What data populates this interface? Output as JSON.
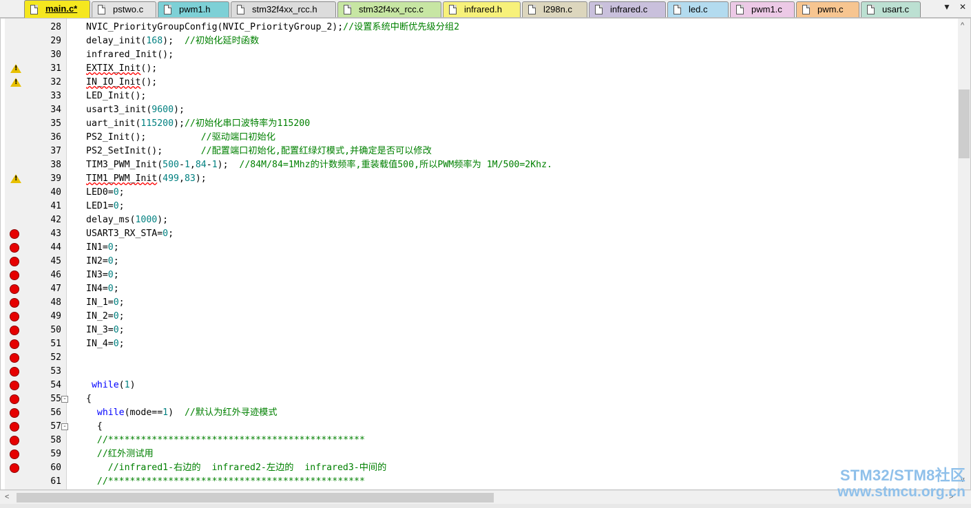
{
  "tabs": [
    {
      "label": "main.c*",
      "color": "#f5e71f",
      "active": true
    },
    {
      "label": "pstwo.c",
      "color": "#e3e3e3",
      "active": false
    },
    {
      "label": "pwm1.h",
      "color": "#7dd0d6",
      "active": false
    },
    {
      "label": "stm32f4xx_rcc.h",
      "color": "#dcdcdc",
      "active": false
    },
    {
      "label": "stm32f4xx_rcc.c",
      "color": "#c7e6a3",
      "active": false
    },
    {
      "label": "infrared.h",
      "color": "#f7f17a",
      "active": false
    },
    {
      "label": "l298n.c",
      "color": "#dcd6bd",
      "active": false
    },
    {
      "label": "infrared.c",
      "color": "#c9c0dc",
      "active": false
    },
    {
      "label": "led.c",
      "color": "#b3dbef",
      "active": false
    },
    {
      "label": "pwm1.c",
      "color": "#ecc9e6",
      "active": false
    },
    {
      "label": "pwm.c",
      "color": "#f7c590",
      "active": false
    },
    {
      "label": "usart.c",
      "color": "#bce0d2",
      "active": false
    }
  ],
  "tab_menu_icon": "▼",
  "tab_close_icon": "✕",
  "scroll_icons": {
    "up": "^",
    "down": "v",
    "left": "<",
    "right": ">"
  },
  "lines": [
    {
      "num": "28",
      "marker": "",
      "fold": "",
      "code": [
        [
          "t",
          "NVIC_PriorityGroupConfig(NVIC_PriorityGroup_2);"
        ],
        [
          "c",
          "//设置系统中断优先级分组2"
        ]
      ]
    },
    {
      "num": "29",
      "marker": "",
      "fold": "",
      "code": [
        [
          "t",
          "delay_init("
        ],
        [
          "n",
          "168"
        ],
        [
          "t",
          ");  "
        ],
        [
          "c",
          "//初始化延时函数"
        ]
      ]
    },
    {
      "num": "30",
      "marker": "",
      "fold": "",
      "code": [
        [
          "t",
          "infrared_Init();"
        ]
      ]
    },
    {
      "num": "31",
      "marker": "warning",
      "fold": "",
      "code": [
        [
          "e",
          "EXTIX_Init"
        ],
        [
          "t",
          "();"
        ]
      ]
    },
    {
      "num": "32",
      "marker": "warning",
      "fold": "",
      "code": [
        [
          "e",
          "IN_IO_Init"
        ],
        [
          "t",
          "();"
        ]
      ]
    },
    {
      "num": "33",
      "marker": "",
      "fold": "",
      "code": [
        [
          "t",
          "LED_Init();"
        ]
      ]
    },
    {
      "num": "34",
      "marker": "",
      "fold": "",
      "code": [
        [
          "t",
          "usart3_init("
        ],
        [
          "n",
          "9600"
        ],
        [
          "t",
          ");"
        ]
      ]
    },
    {
      "num": "35",
      "marker": "",
      "fold": "",
      "code": [
        [
          "t",
          "uart_init("
        ],
        [
          "n",
          "115200"
        ],
        [
          "t",
          ");"
        ],
        [
          "c",
          "//初始化串口波特率为115200"
        ]
      ]
    },
    {
      "num": "36",
      "marker": "",
      "fold": "",
      "code": [
        [
          "t",
          "PS2_Init();          "
        ],
        [
          "c",
          "//驱动端口初始化"
        ]
      ]
    },
    {
      "num": "37",
      "marker": "",
      "fold": "",
      "code": [
        [
          "t",
          "PS2_SetInit();       "
        ],
        [
          "c",
          "//配置端口初始化,配置红绿灯模式,并确定是否可以修改"
        ]
      ]
    },
    {
      "num": "38",
      "marker": "",
      "fold": "",
      "code": [
        [
          "t",
          "TIM3_PWM_Init("
        ],
        [
          "n",
          "500"
        ],
        [
          "t",
          "-"
        ],
        [
          "n",
          "1"
        ],
        [
          "t",
          ","
        ],
        [
          "n",
          "84"
        ],
        [
          "t",
          "-"
        ],
        [
          "n",
          "1"
        ],
        [
          "t",
          ");  "
        ],
        [
          "c",
          "//84M/84=1Mhz的计数频率,重装载值500,所以PWM频率为 1M/500=2Khz."
        ]
      ]
    },
    {
      "num": "39",
      "marker": "warning",
      "fold": "",
      "code": [
        [
          "e",
          "TIM1_PWM_Init"
        ],
        [
          "t",
          "("
        ],
        [
          "n",
          "499"
        ],
        [
          "t",
          ","
        ],
        [
          "n",
          "83"
        ],
        [
          "t",
          ");"
        ]
      ]
    },
    {
      "num": "40",
      "marker": "",
      "fold": "",
      "code": [
        [
          "t",
          "LED0="
        ],
        [
          "n",
          "0"
        ],
        [
          "t",
          ";"
        ]
      ]
    },
    {
      "num": "41",
      "marker": "",
      "fold": "",
      "code": [
        [
          "t",
          "LED1="
        ],
        [
          "n",
          "0"
        ],
        [
          "t",
          ";"
        ]
      ]
    },
    {
      "num": "42",
      "marker": "",
      "fold": "",
      "code": [
        [
          "t",
          "delay_ms("
        ],
        [
          "n",
          "1000"
        ],
        [
          "t",
          ");"
        ]
      ]
    },
    {
      "num": "43",
      "marker": "breakpoint",
      "fold": "",
      "code": [
        [
          "t",
          "USART3_RX_STA="
        ],
        [
          "n",
          "0"
        ],
        [
          "t",
          ";"
        ]
      ]
    },
    {
      "num": "44",
      "marker": "breakpoint",
      "fold": "",
      "code": [
        [
          "t",
          "IN1="
        ],
        [
          "n",
          "0"
        ],
        [
          "t",
          ";"
        ]
      ]
    },
    {
      "num": "45",
      "marker": "breakpoint",
      "fold": "",
      "code": [
        [
          "t",
          "IN2="
        ],
        [
          "n",
          "0"
        ],
        [
          "t",
          ";"
        ]
      ]
    },
    {
      "num": "46",
      "marker": "breakpoint",
      "fold": "",
      "code": [
        [
          "t",
          "IN3="
        ],
        [
          "n",
          "0"
        ],
        [
          "t",
          ";"
        ]
      ]
    },
    {
      "num": "47",
      "marker": "breakpoint",
      "fold": "",
      "code": [
        [
          "t",
          "IN4="
        ],
        [
          "n",
          "0"
        ],
        [
          "t",
          ";"
        ]
      ]
    },
    {
      "num": "48",
      "marker": "breakpoint",
      "fold": "",
      "code": [
        [
          "t",
          "IN_1="
        ],
        [
          "n",
          "0"
        ],
        [
          "t",
          ";"
        ]
      ]
    },
    {
      "num": "49",
      "marker": "breakpoint",
      "fold": "",
      "code": [
        [
          "t",
          "IN_2="
        ],
        [
          "n",
          "0"
        ],
        [
          "t",
          ";"
        ]
      ]
    },
    {
      "num": "50",
      "marker": "breakpoint",
      "fold": "",
      "code": [
        [
          "t",
          "IN_3="
        ],
        [
          "n",
          "0"
        ],
        [
          "t",
          ";"
        ]
      ]
    },
    {
      "num": "51",
      "marker": "breakpoint",
      "fold": "",
      "code": [
        [
          "t",
          "IN_4="
        ],
        [
          "n",
          "0"
        ],
        [
          "t",
          ";"
        ]
      ]
    },
    {
      "num": "52",
      "marker": "breakpoint",
      "fold": "",
      "code": []
    },
    {
      "num": "53",
      "marker": "breakpoint",
      "fold": "",
      "code": []
    },
    {
      "num": "54",
      "marker": "breakpoint",
      "fold": "",
      "code": [
        [
          "t",
          " "
        ],
        [
          "k",
          "while"
        ],
        [
          "t",
          "("
        ],
        [
          "n",
          "1"
        ],
        [
          "t",
          ")"
        ]
      ]
    },
    {
      "num": "55",
      "marker": "breakpoint",
      "fold": "-",
      "code": [
        [
          "t",
          "{"
        ]
      ]
    },
    {
      "num": "56",
      "marker": "breakpoint",
      "fold": "",
      "code": [
        [
          "t",
          "  "
        ],
        [
          "k",
          "while"
        ],
        [
          "t",
          "(mode=="
        ],
        [
          "n",
          "1"
        ],
        [
          "t",
          ")  "
        ],
        [
          "c",
          "//默认为红外寻迹模式"
        ]
      ]
    },
    {
      "num": "57",
      "marker": "breakpoint",
      "fold": "-",
      "code": [
        [
          "t",
          "  {"
        ]
      ]
    },
    {
      "num": "58",
      "marker": "breakpoint",
      "fold": "",
      "code": [
        [
          "t",
          "  "
        ],
        [
          "c",
          "//***********************************************"
        ]
      ]
    },
    {
      "num": "59",
      "marker": "breakpoint",
      "fold": "",
      "code": [
        [
          "t",
          "  "
        ],
        [
          "c",
          "//红外测试用"
        ]
      ]
    },
    {
      "num": "60",
      "marker": "breakpoint",
      "fold": "",
      "code": [
        [
          "t",
          "    "
        ],
        [
          "c",
          "//infrared1-右边的  infrared2-左边的  infrared3-中间的"
        ]
      ]
    },
    {
      "num": "61",
      "marker": "",
      "fold": "",
      "code": [
        [
          "t",
          "  "
        ],
        [
          "c",
          "//***********************************************"
        ]
      ]
    }
  ],
  "watermark": {
    "line1": "STM32/STM8社区",
    "line2": "www.stmcu.org.cn"
  }
}
